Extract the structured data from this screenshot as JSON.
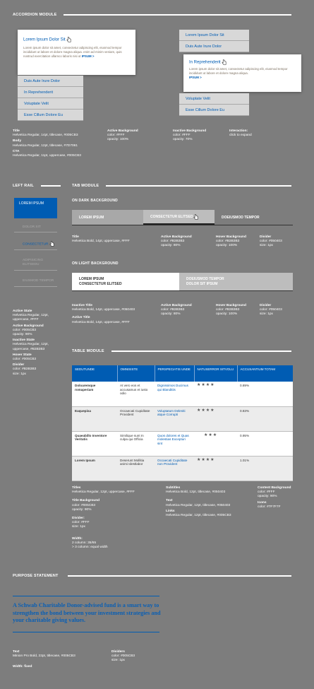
{
  "accordion": {
    "heading": "Accordion Module",
    "left_open": {
      "title": "Lorem Ipsum Dolor Sit",
      "body": "Lorem ipsum dolor sit amet, consectetur adipiscing elit, eiusmod tempor incididunt ut labore et dolore magna aliqua. enim ad minim veniam, quis nostrud exercitation ullamco laboris nisi ut",
      "cta": "IPSUM >"
    },
    "left_items": [
      "Duis Aute Irure Dolor",
      "In Reprehenderit",
      "Voluptate Velit",
      "Esse Cillum Dolore Eu"
    ],
    "right_top": [
      "Lorem Ipsum Dolor Sit",
      "Duis Aute Irure Dolor"
    ],
    "right_open": {
      "title": "In Reprehenderit",
      "body": "Lorem ipsum dolor sit amet, consectetur adipiscing elit, eiusmod tempor incididunt ut labore et dolore magna aliqua.",
      "cta": "IPSUM >"
    },
    "right_bottom": [
      "Voluptate Velit",
      "Esse Cillum Dolore Eu"
    ],
    "specs": {
      "title_label": "Title",
      "title_val": "Helvetica Regular, 14pt, titlecase, #005CB3",
      "body_label": "Body",
      "body_val": "Helvetica Regular, 12pt, titlecase, #7D7061",
      "cta_label": "CTA",
      "cta_val": "Helvetica Regular, 11pt, uppercase, #005CB3",
      "active_label": "Active Background",
      "active_val1": "color: #FFF",
      "active_val2": "opacity: 100%",
      "inactive_label": "Inactive Background",
      "inactive_val1": "color: #FFF",
      "inactive_val2": "opacity: 70%",
      "interaction_label": "Interaction:",
      "interaction_val": "click to expand"
    }
  },
  "left_rail": {
    "heading": "Left Rail",
    "items": [
      "LOREM IPSUM",
      "DOLOR SIT",
      "CONSECTETUR",
      "ADIPISICING ELITSEDU",
      "EIUSMOD TEMPOR"
    ],
    "specs": [
      {
        "label": "Active State",
        "lines": [
          "Helvetica Regular, 12pt,",
          "uppercase, #FFF"
        ]
      },
      {
        "label": "Active Background",
        "lines": [
          "color: #005CB3",
          "opacity: 90%"
        ]
      },
      {
        "label": "Inactive State",
        "lines": [
          "Helvetica Regular, 12pt,",
          "uppercase, #B3B3B3"
        ]
      },
      {
        "label": "Hover State",
        "lines": [
          "color: #005CB3"
        ]
      },
      {
        "label": "Divider",
        "lines": [
          "color: #B3B3B3",
          "size: 1px"
        ]
      }
    ]
  },
  "tab_module": {
    "heading": "Tab Module",
    "dark_heading": "On Dark Background",
    "dark_tabs": [
      "LOREM IPSUM",
      "CONSECTETUR ELITSED",
      "DOEIUSMOD TEMPOR"
    ],
    "dark_specs": [
      {
        "label": "Title",
        "lines": [
          "Helvetica Bold, 14pt, uppercase, #FFF"
        ]
      },
      {
        "label": "Active Background",
        "lines": [
          "color: #B3B3B3",
          "opacity: 80%"
        ]
      },
      {
        "label": "Hover Background",
        "lines": [
          "color: #B3B3B3",
          "opacity: 100%"
        ]
      },
      {
        "label": "Divider",
        "lines": [
          "color: #050403",
          "size: 1px"
        ]
      }
    ],
    "light_heading": "On Light Background",
    "light_tabs": [
      [
        "LOREM IPSUM",
        "CONSECTETUR ELITSED"
      ],
      [
        "DOEIUSMOD TEMPOR",
        "DOLOR SIT IPSUM"
      ]
    ],
    "light_specs": [
      {
        "label": "Inactive Title",
        "lines": [
          "Helvetica Bold, 14pt, uppercase, #050403"
        ]
      },
      {
        "label": "Active Title",
        "lines": [
          "Helvetica Bold, 14pt, uppercase, #FFF"
        ]
      },
      {
        "label": "Active Background",
        "lines": [
          "color: #B3B3B3",
          "opacity: 80%"
        ]
      },
      {
        "label": "Hover Background",
        "lines": [
          "color: #B3B3B3",
          "opacity: 100%"
        ]
      },
      {
        "label": "Divider",
        "lines": [
          "color: #050403",
          "size: 1px"
        ]
      }
    ]
  },
  "table_module": {
    "heading": "Table Module",
    "columns": [
      "SEDUTUNDE",
      "OMNISISTE",
      "PERSPECIATIS UNDE",
      "NATUSERROR SITVOLU",
      "ACCUSANTIUM TOTAM"
    ],
    "rows": [
      {
        "title": "Doloaremque romaperiam",
        "text": "At vero eos et accusamus et iusto odio",
        "link": "Dignissimos Ducimus qui Blanditiis",
        "stars": "★★★★",
        "pct": "0.89%"
      },
      {
        "title": "Eaquepisa",
        "text": "Occaecati Cupiditate Provident",
        "link": "Voluptatum Deleniti atque Corrupti",
        "stars": "★★★★",
        "pct": "0.83%"
      },
      {
        "title": "Quaeabillo Inventore Veritatis",
        "text": "Similique sunt In culpa qui Officia",
        "link": "Quos dolores et Quas molestias Excepturi sint",
        "stars": "★★★",
        "pct": "0.95%"
      },
      {
        "title": "Lorem Ipsum",
        "text": "Deserunt Mollitia animi Idestlabor",
        "link": "Occaecati Cupiditate non Provident",
        "stars": "★★★★",
        "pct": "1.01%"
      }
    ],
    "specs": [
      {
        "label": "Titles",
        "lines": [
          "Helvetica Regular, 12pt, uppercase, #FFF"
        ]
      },
      {
        "label": "Title Background",
        "lines": [
          "color: #005CB3",
          "opacity: 90%"
        ]
      },
      {
        "label": "Divider:",
        "lines": [
          "color: #FFF",
          "size: 1px"
        ]
      },
      {
        "label": "Width:",
        "lines": [
          "2 column: 35/65",
          "> 3 column: equal width"
        ]
      },
      {
        "label": "Subtitles",
        "lines": [
          "Helvetica Bold, 12pt, titlecase, #050403"
        ]
      },
      {
        "label": "Text",
        "lines": [
          "Helvetica Regular, 12pt, titlecase, #050403"
        ]
      },
      {
        "label": "Links",
        "lines": [
          "Helvetica Regular, 12pt, titlecase, #005CB3"
        ]
      },
      {
        "label": "Content Background",
        "lines": [
          "color: #FFF",
          "opacity: 90%"
        ]
      },
      {
        "label": "Icons",
        "lines": [
          "color: #7F7F7F"
        ]
      }
    ]
  },
  "purpose": {
    "heading": "Purpose Statement",
    "statement": "A Schwab Charitable Donor-advised fund is a smart way to strengthen the bond between your investment strategies and your charitable giving values.",
    "specs": [
      {
        "label": "Text",
        "lines": [
          "Minion Pro Bold, 22pt, titlecase, #005CB3"
        ]
      },
      {
        "label": "Width: fixed",
        "lines": []
      },
      {
        "label": "Dividers",
        "lines": [
          "color: #005CB3",
          "size: 1px"
        ]
      }
    ]
  }
}
